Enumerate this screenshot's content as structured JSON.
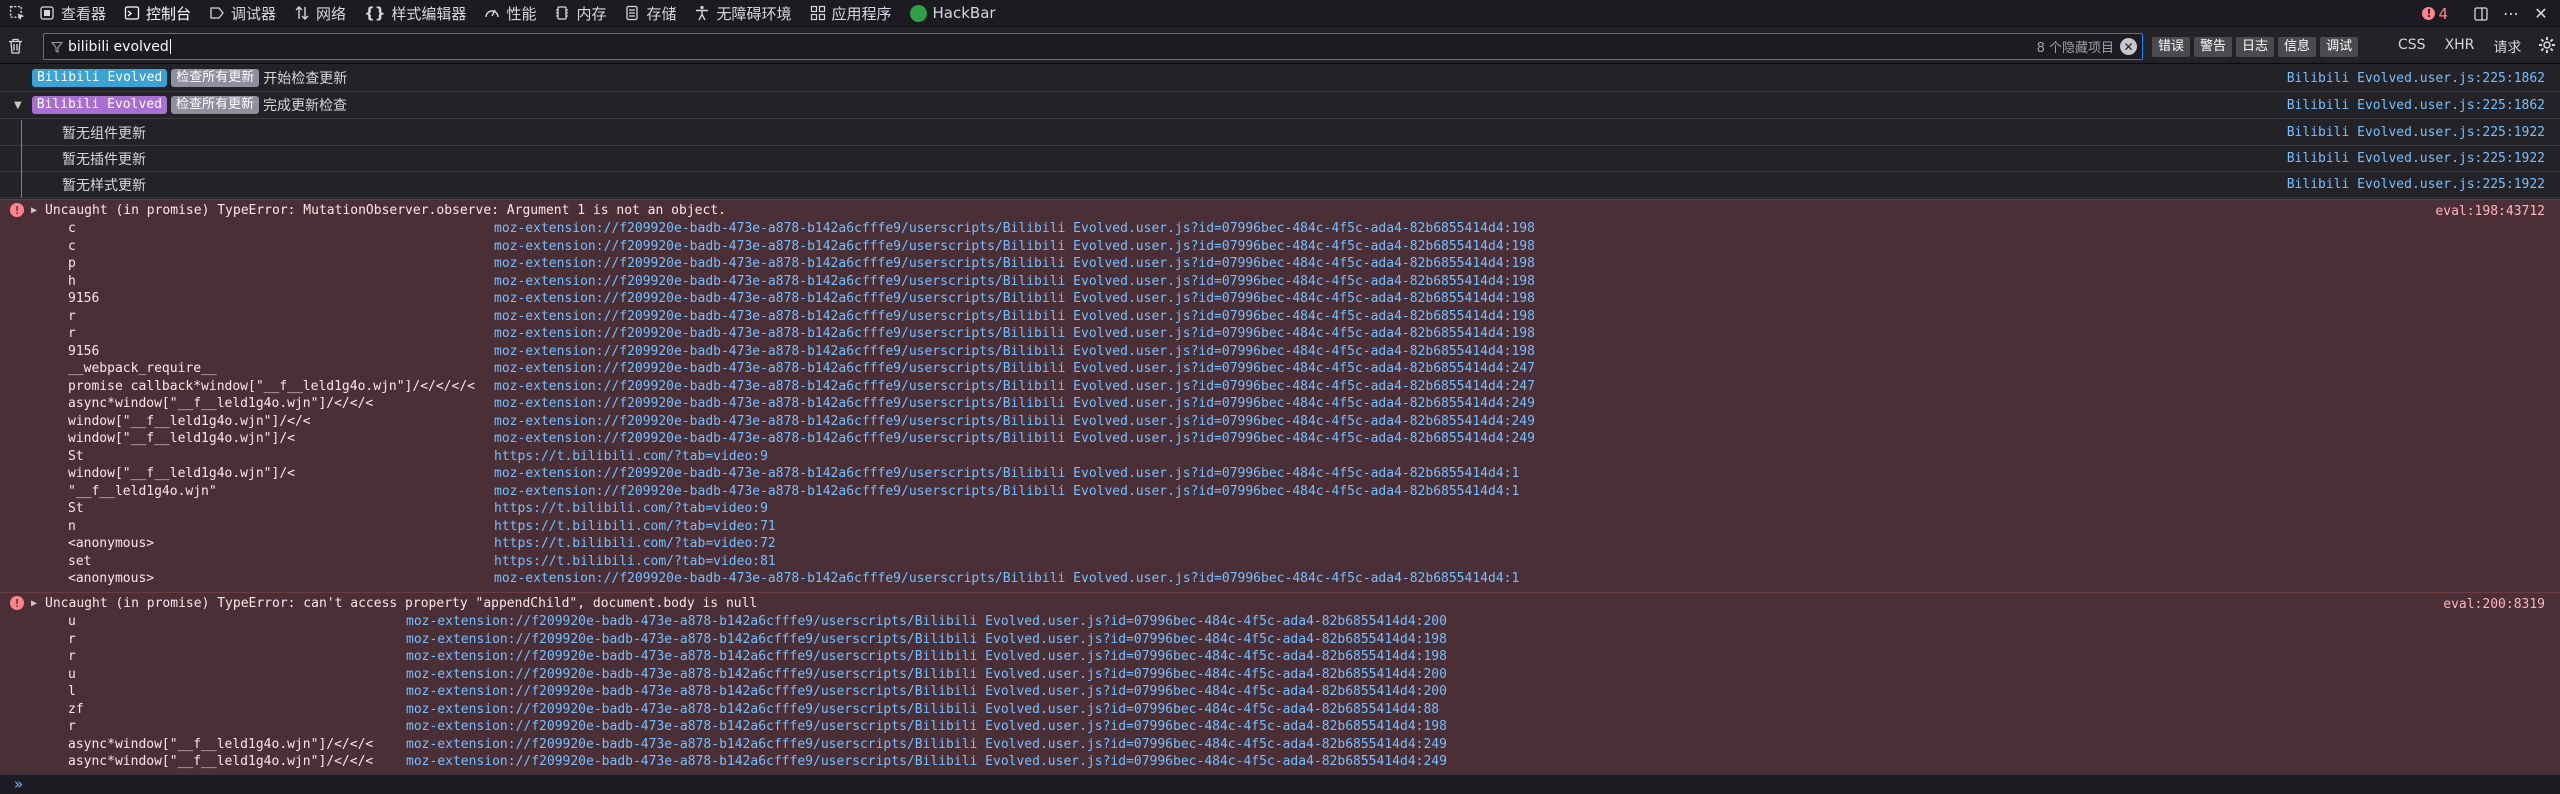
{
  "toolbar": {
    "tabs": [
      {
        "label": "查看器",
        "icon": "inspector-icon"
      },
      {
        "label": "控制台",
        "icon": "console-icon",
        "selected": true
      },
      {
        "label": "调试器",
        "icon": "debugger-icon"
      },
      {
        "label": "网络",
        "icon": "network-icon"
      },
      {
        "label": "样式编辑器",
        "icon": "style-editor-icon"
      },
      {
        "label": "性能",
        "icon": "performance-icon"
      },
      {
        "label": "内存",
        "icon": "memory-icon"
      },
      {
        "label": "存储",
        "icon": "storage-icon"
      },
      {
        "label": "无障碍环境",
        "icon": "accessibility-icon"
      },
      {
        "label": "应用程序",
        "icon": "application-icon"
      },
      {
        "label": "HackBar",
        "icon": "hackbar-icon"
      }
    ],
    "error_count": "4"
  },
  "filterbar": {
    "filter_value": "bilibili evolved",
    "hidden_count": "8 个隐藏项目",
    "levels": [
      "错误",
      "警告",
      "日志",
      "信息",
      "调试"
    ],
    "extra": [
      "CSS",
      "XHR",
      "请求"
    ]
  },
  "messages": {
    "row1": {
      "badge1": "Bilibili Evolved",
      "badge2": "检查所有更新",
      "text": "开始检查更新",
      "loc": "Bilibili Evolved.user.js:225:1862"
    },
    "row2": {
      "badge1": "Bilibili Evolved",
      "badge2": "检查所有更新",
      "text": "完成更新检查",
      "loc": "Bilibili Evolved.user.js:225:1862"
    },
    "nested": [
      {
        "text": "暂无组件更新",
        "loc": "Bilibili Evolved.user.js:225:1922"
      },
      {
        "text": "暂无插件更新",
        "loc": "Bilibili Evolved.user.js:225:1922"
      },
      {
        "text": "暂无样式更新",
        "loc": "Bilibili Evolved.user.js:225:1922"
      }
    ]
  },
  "errors": [
    {
      "message": "Uncaught (in promise) TypeError: MutationObserver.observe: Argument 1 is not an object.",
      "loc": "eval:198:43712",
      "frames": [
        {
          "fn": "c",
          "loc": "moz-extension://f209920e-badb-473e-a878-b142a6cfffe9/userscripts/Bilibili Evolved.user.js?id=07996bec-484c-4f5c-ada4-82b6855414d4:198"
        },
        {
          "fn": "c",
          "loc": "moz-extension://f209920e-badb-473e-a878-b142a6cfffe9/userscripts/Bilibili Evolved.user.js?id=07996bec-484c-4f5c-ada4-82b6855414d4:198"
        },
        {
          "fn": "p",
          "loc": "moz-extension://f209920e-badb-473e-a878-b142a6cfffe9/userscripts/Bilibili Evolved.user.js?id=07996bec-484c-4f5c-ada4-82b6855414d4:198"
        },
        {
          "fn": "h",
          "loc": "moz-extension://f209920e-badb-473e-a878-b142a6cfffe9/userscripts/Bilibili Evolved.user.js?id=07996bec-484c-4f5c-ada4-82b6855414d4:198"
        },
        {
          "fn": "9156",
          "loc": "moz-extension://f209920e-badb-473e-a878-b142a6cfffe9/userscripts/Bilibili Evolved.user.js?id=07996bec-484c-4f5c-ada4-82b6855414d4:198"
        },
        {
          "fn": "r",
          "loc": "moz-extension://f209920e-badb-473e-a878-b142a6cfffe9/userscripts/Bilibili Evolved.user.js?id=07996bec-484c-4f5c-ada4-82b6855414d4:198"
        },
        {
          "fn": "r",
          "loc": "moz-extension://f209920e-badb-473e-a878-b142a6cfffe9/userscripts/Bilibili Evolved.user.js?id=07996bec-484c-4f5c-ada4-82b6855414d4:198"
        },
        {
          "fn": "9156",
          "loc": "moz-extension://f209920e-badb-473e-a878-b142a6cfffe9/userscripts/Bilibili Evolved.user.js?id=07996bec-484c-4f5c-ada4-82b6855414d4:198"
        },
        {
          "fn": "__webpack_require__",
          "loc": "moz-extension://f209920e-badb-473e-a878-b142a6cfffe9/userscripts/Bilibili Evolved.user.js?id=07996bec-484c-4f5c-ada4-82b6855414d4:247"
        },
        {
          "fn": "promise callback*window[\"__f__leld1g4o.wjn\"]/</</</<",
          "loc": "moz-extension://f209920e-badb-473e-a878-b142a6cfffe9/userscripts/Bilibili Evolved.user.js?id=07996bec-484c-4f5c-ada4-82b6855414d4:247"
        },
        {
          "fn": "async*window[\"__f__leld1g4o.wjn\"]/</</<",
          "loc": "moz-extension://f209920e-badb-473e-a878-b142a6cfffe9/userscripts/Bilibili Evolved.user.js?id=07996bec-484c-4f5c-ada4-82b6855414d4:249"
        },
        {
          "fn": "window[\"__f__leld1g4o.wjn\"]/</<",
          "loc": "moz-extension://f209920e-badb-473e-a878-b142a6cfffe9/userscripts/Bilibili Evolved.user.js?id=07996bec-484c-4f5c-ada4-82b6855414d4:249"
        },
        {
          "fn": "window[\"__f__leld1g4o.wjn\"]/<",
          "loc": "moz-extension://f209920e-badb-473e-a878-b142a6cfffe9/userscripts/Bilibili Evolved.user.js?id=07996bec-484c-4f5c-ada4-82b6855414d4:249"
        },
        {
          "fn": "St",
          "loc": "https://t.bilibili.com/?tab=video:9"
        },
        {
          "fn": "window[\"__f__leld1g4o.wjn\"]/<",
          "loc": "moz-extension://f209920e-badb-473e-a878-b142a6cfffe9/userscripts/Bilibili Evolved.user.js?id=07996bec-484c-4f5c-ada4-82b6855414d4:1"
        },
        {
          "fn": "\"__f__leld1g4o.wjn\"",
          "loc": "moz-extension://f209920e-badb-473e-a878-b142a6cfffe9/userscripts/Bilibili Evolved.user.js?id=07996bec-484c-4f5c-ada4-82b6855414d4:1"
        },
        {
          "fn": "St",
          "loc": "https://t.bilibili.com/?tab=video:9"
        },
        {
          "fn": "n",
          "loc": "https://t.bilibili.com/?tab=video:71"
        },
        {
          "fn": "<anonymous>",
          "loc": "https://t.bilibili.com/?tab=video:72"
        },
        {
          "fn": "set",
          "loc": "https://t.bilibili.com/?tab=video:81"
        },
        {
          "fn": "<anonymous>",
          "loc": "moz-extension://f209920e-badb-473e-a878-b142a6cfffe9/userscripts/Bilibili Evolved.user.js?id=07996bec-484c-4f5c-ada4-82b6855414d4:1"
        }
      ]
    },
    {
      "message": "Uncaught (in promise) TypeError: can't access property \"appendChild\", document.body is null",
      "loc": "eval:200:8319",
      "frames": [
        {
          "fn": "u",
          "loc": "moz-extension://f209920e-badb-473e-a878-b142a6cfffe9/userscripts/Bilibili Evolved.user.js?id=07996bec-484c-4f5c-ada4-82b6855414d4:200"
        },
        {
          "fn": "r",
          "loc": "moz-extension://f209920e-badb-473e-a878-b142a6cfffe9/userscripts/Bilibili Evolved.user.js?id=07996bec-484c-4f5c-ada4-82b6855414d4:198"
        },
        {
          "fn": "r",
          "loc": "moz-extension://f209920e-badb-473e-a878-b142a6cfffe9/userscripts/Bilibili Evolved.user.js?id=07996bec-484c-4f5c-ada4-82b6855414d4:198"
        },
        {
          "fn": "u",
          "loc": "moz-extension://f209920e-badb-473e-a878-b142a6cfffe9/userscripts/Bilibili Evolved.user.js?id=07996bec-484c-4f5c-ada4-82b6855414d4:200"
        },
        {
          "fn": "l",
          "loc": "moz-extension://f209920e-badb-473e-a878-b142a6cfffe9/userscripts/Bilibili Evolved.user.js?id=07996bec-484c-4f5c-ada4-82b6855414d4:200"
        },
        {
          "fn": "zf",
          "loc": "moz-extension://f209920e-badb-473e-a878-b142a6cfffe9/userscripts/Bilibili Evolved.user.js?id=07996bec-484c-4f5c-ada4-82b6855414d4:88"
        },
        {
          "fn": "r",
          "loc": "moz-extension://f209920e-badb-473e-a878-b142a6cfffe9/userscripts/Bilibili Evolved.user.js?id=07996bec-484c-4f5c-ada4-82b6855414d4:198"
        },
        {
          "fn": "async*window[\"__f__leld1g4o.wjn\"]/</</<",
          "loc": "moz-extension://f209920e-badb-473e-a878-b142a6cfffe9/userscripts/Bilibili Evolved.user.js?id=07996bec-484c-4f5c-ada4-82b6855414d4:249"
        },
        {
          "fn": "async*window[\"__f__leld1g4o.wjn\"]/</</<",
          "loc": "moz-extension://f209920e-badb-473e-a878-b142a6cfffe9/userscripts/Bilibili Evolved.user.js?id=07996bec-484c-4f5c-ada4-82b6855414d4:249"
        }
      ]
    }
  ],
  "colors": {
    "error_bg": "#4b2f36",
    "link": "#75bfff",
    "accent": "#0a84ff",
    "badge_blue": "#3ba2d6",
    "badge_purple": "#a86ed1"
  }
}
